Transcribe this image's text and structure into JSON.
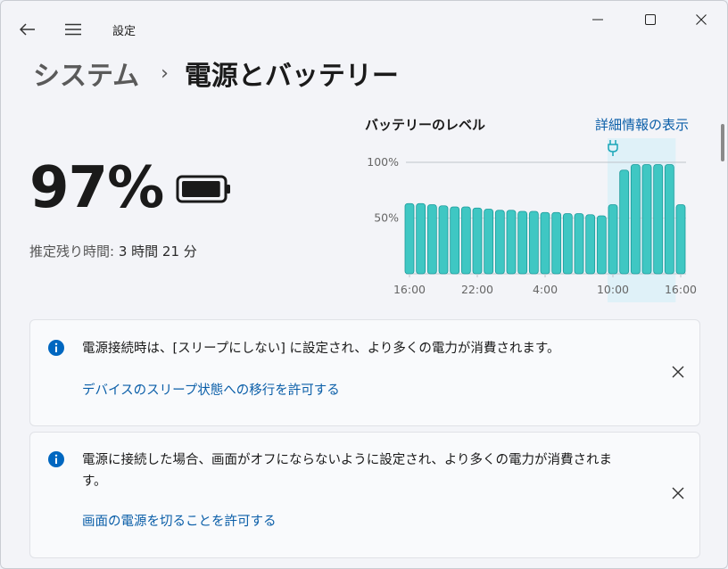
{
  "app": {
    "title": "設定"
  },
  "titlebar": {
    "back_icon": "back-arrow-icon",
    "menu_icon": "hamburger-menu-icon",
    "minimize_icon": "minimize-icon",
    "maximize_icon": "maximize-icon",
    "close_icon": "close-icon"
  },
  "breadcrumb": {
    "parent": "システム",
    "separator": "›",
    "current": "電源とバッテリー"
  },
  "battery": {
    "percent_text": "97%",
    "level_fraction": 0.97,
    "remaining_label": "推定残り時間:",
    "remaining_value": "3 時間 21 分"
  },
  "chart_data": {
    "type": "bar",
    "title": "バッテリーのレベル",
    "x_ticks": [
      "16:00",
      "22:00",
      "4:00",
      "10:00",
      "16:00"
    ],
    "y_ticks": [
      "100%",
      "50%"
    ],
    "ylim": [
      0,
      100
    ],
    "values": [
      63,
      63,
      62,
      61,
      60,
      60,
      59,
      58,
      57,
      57,
      56,
      56,
      55,
      55,
      54,
      54,
      53,
      52,
      62,
      93,
      98,
      98,
      98,
      98,
      62
    ],
    "plugged_in_icon": "plug-icon",
    "plugged_in_from_index": 18,
    "bar_color": "#3fc7c3",
    "highlight_color": "#dff1f8"
  },
  "details_link": "詳細情報の表示",
  "cards": [
    {
      "message": "電源接続時は、[スリープにしない] に設定され、より多くの電力が消費されます。",
      "link": "デバイスのスリープ状態への移行を許可する"
    },
    {
      "message": "電源に接続した場合、画面がオフにならないように設定され、より多くの電力が消費されます。",
      "link": "画面の電源を切ることを許可する"
    }
  ],
  "colors": {
    "accent": "#0a5ea8",
    "info": "#0067c0"
  }
}
